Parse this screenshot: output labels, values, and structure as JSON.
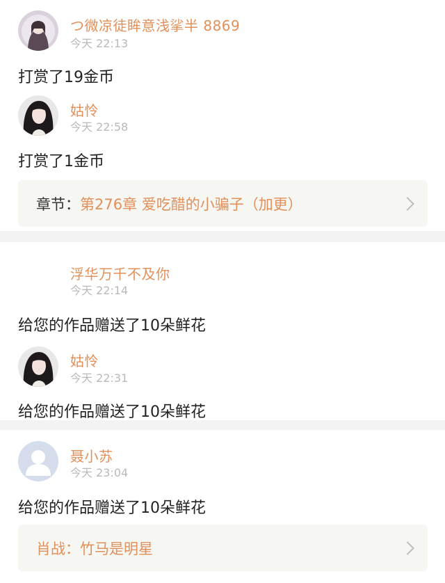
{
  "blocks": [
    {
      "messages": [
        {
          "user": "つ微凉徒眸意浅挲半 8869",
          "time": "今天 22:13",
          "text": "打赏了19金币",
          "avatar": "girl-avatar-icon"
        },
        {
          "user": "姑怜",
          "time": "今天 22:58",
          "text": "打赏了1金币",
          "avatar": "dark-hair-avatar-icon"
        }
      ],
      "chapter": {
        "label": "章节：",
        "title": "第276章 爱吃醋的小骗子（加更）"
      }
    },
    {
      "messages": [
        {
          "user": "浮华万千不及你",
          "time": "今天 22:14",
          "text": "给您的作品赠送了10朵鲜花",
          "avatar": ""
        },
        {
          "user": "姑怜",
          "time": "今天 22:31",
          "text": "给您的作品赠送了10朵鲜花",
          "avatar": "dark-hair-avatar-icon"
        }
      ]
    },
    {
      "messages": [
        {
          "user": "聂小苏",
          "time": "今天 23:04",
          "text": "给您的作品赠送了10朵鲜花",
          "avatar": "default-avatar-icon"
        }
      ],
      "chapter": {
        "label": "肖战：",
        "title": "竹马是明星"
      }
    }
  ],
  "colors": {
    "accent": "#e2905a",
    "time": "#b9b9b9",
    "separator": "#f3f3f3",
    "chapter_bg": "#f6f6f2"
  }
}
